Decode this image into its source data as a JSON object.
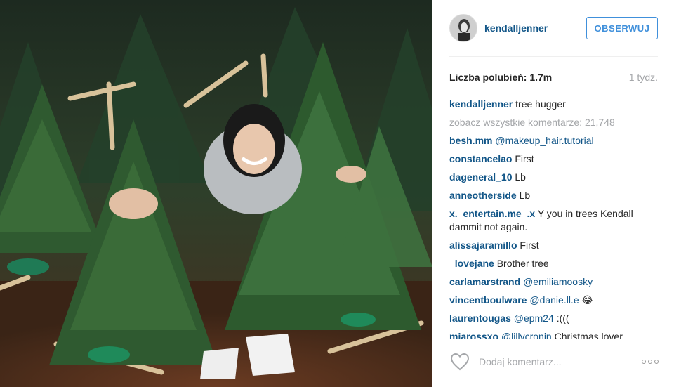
{
  "post": {
    "username": "kendalljenner",
    "follow_label": "OBSERWUJ",
    "likes_text": "Liczba polubień: 1.7m",
    "time_ago": "1 tydz.",
    "caption": {
      "user": "kendalljenner",
      "text": "tree hugger"
    },
    "view_all_comments": "zobacz wszystkie komentarze: 21,748",
    "comments": [
      {
        "user": "besh.mm",
        "mention": "@makeup_hair.tutorial",
        "text": ""
      },
      {
        "user": "constancelao",
        "mention": "",
        "text": "First"
      },
      {
        "user": "dageneral_10",
        "mention": "",
        "text": "Lb"
      },
      {
        "user": "anneotherside",
        "mention": "",
        "text": "Lb"
      },
      {
        "user": "x._entertain.me_.x",
        "mention": "",
        "text": "Y you in trees Kendall dammit not again."
      },
      {
        "user": "alissajaramillo",
        "mention": "",
        "text": "First"
      },
      {
        "user": "_lovejane",
        "mention": "",
        "text": "Brother tree"
      },
      {
        "user": "carlamarstrand",
        "mention": "@emiliamoosky",
        "text": ""
      },
      {
        "user": "vincentboulware",
        "mention": "@danie.ll.e",
        "text": "😂"
      },
      {
        "user": "laurentougas",
        "mention": "@epm24",
        "text": ":((("
      },
      {
        "user": "miarossxo",
        "mention": "@lillycronin",
        "text": " Christmas lover"
      }
    ],
    "add_comment_placeholder": "Dodaj komentarz...",
    "icons": {
      "like": "heart-icon",
      "more": "more-options-icon"
    },
    "colors": {
      "link": "#125688",
      "follow": "#4090db",
      "muted": "#a5a7aa"
    }
  }
}
